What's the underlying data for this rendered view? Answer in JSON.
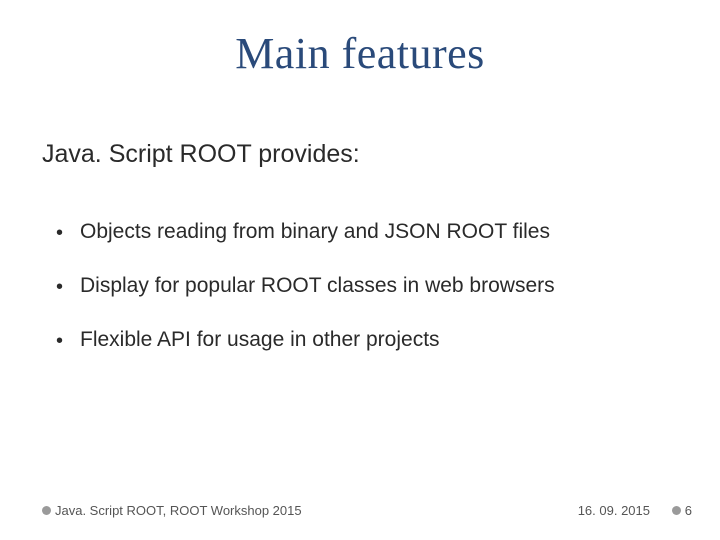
{
  "title": "Main features",
  "subtitle": "Java. Script ROOT provides:",
  "bullets": [
    "Objects reading from binary and JSON ROOT files",
    "Display for popular ROOT classes in web browsers",
    "Flexible API for usage in other projects"
  ],
  "footer": {
    "source": "Java. Script ROOT, ROOT Workshop 2015",
    "date": "16. 09. 2015",
    "page": "6"
  }
}
